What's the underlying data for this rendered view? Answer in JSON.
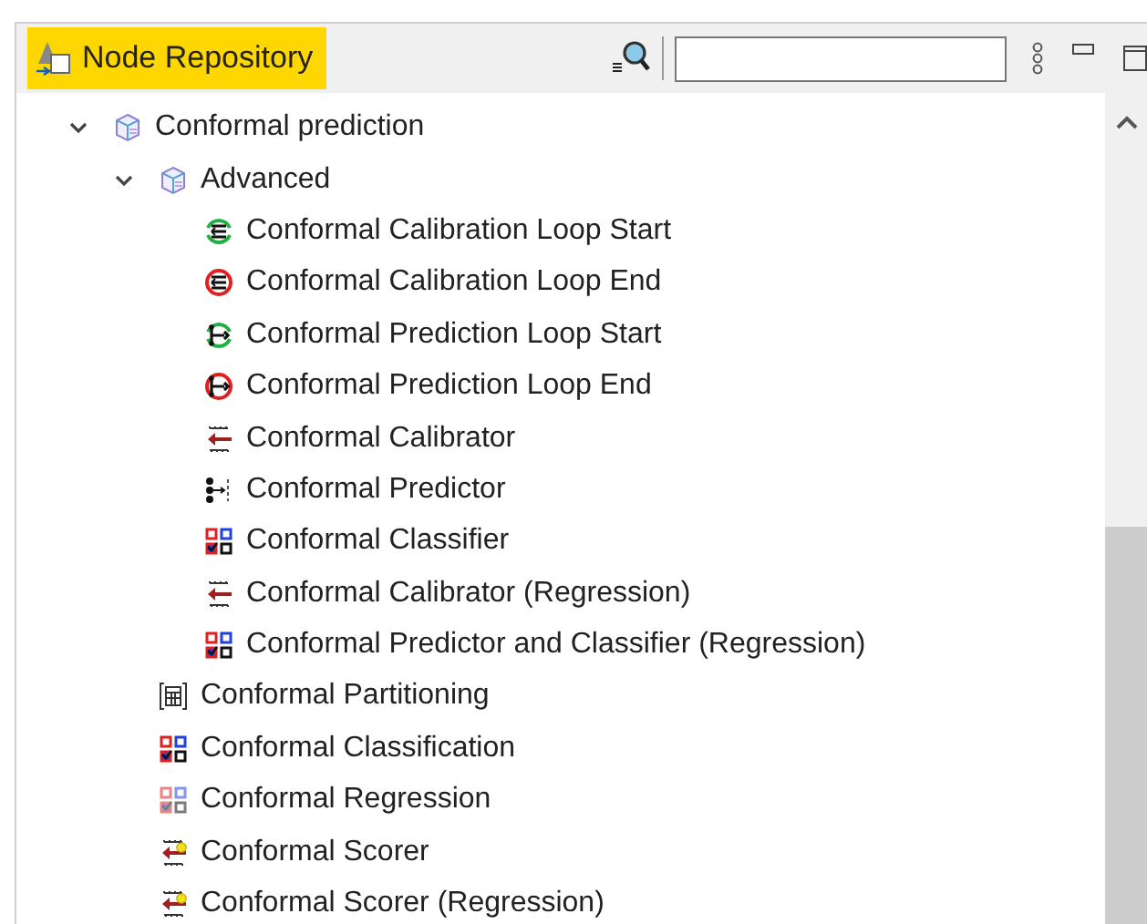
{
  "view": {
    "title": "Node Repository"
  },
  "tree": [
    {
      "label": "Conformal prediction",
      "kind": "category",
      "expanded": true,
      "children": [
        {
          "label": "Advanced",
          "kind": "category",
          "expanded": true,
          "children": [
            {
              "label": "Conformal Calibration Loop Start",
              "kind": "loop-start"
            },
            {
              "label": "Conformal Calibration Loop End",
              "kind": "loop-end"
            },
            {
              "label": "Conformal Prediction Loop Start",
              "kind": "prediction-loop-start"
            },
            {
              "label": "Conformal Prediction Loop End",
              "kind": "prediction-loop-end"
            },
            {
              "label": "Conformal Calibrator",
              "kind": "calibrator"
            },
            {
              "label": "Conformal Predictor",
              "kind": "predictor"
            },
            {
              "label": "Conformal Classifier",
              "kind": "classifier"
            },
            {
              "label": "Conformal Calibrator (Regression)",
              "kind": "calibrator"
            },
            {
              "label": "Conformal Predictor and Classifier (Regression)",
              "kind": "classifier"
            }
          ]
        },
        {
          "label": "Conformal Partitioning",
          "kind": "partitioning"
        },
        {
          "label": "Conformal Classification",
          "kind": "classifier"
        },
        {
          "label": "Conformal Regression",
          "kind": "classifier-light"
        },
        {
          "label": "Conformal Scorer",
          "kind": "scorer"
        },
        {
          "label": "Conformal Scorer (Regression)",
          "kind": "scorer"
        }
      ]
    }
  ]
}
